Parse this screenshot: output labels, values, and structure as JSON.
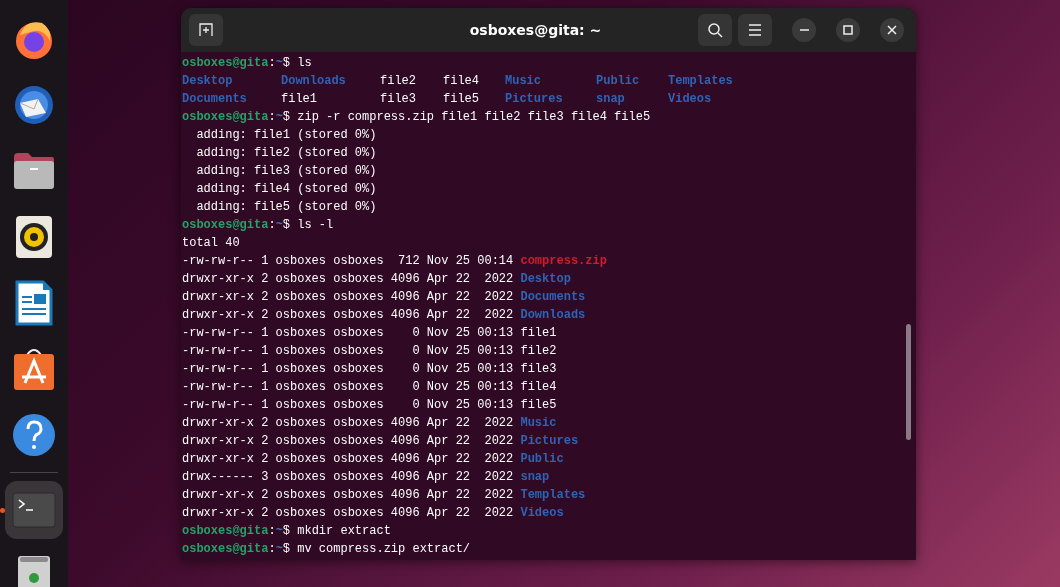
{
  "dock": {
    "items": [
      {
        "kind": "firefox",
        "running": false
      },
      {
        "kind": "mail",
        "running": false
      },
      {
        "kind": "files",
        "running": false
      },
      {
        "kind": "music",
        "running": false
      },
      {
        "kind": "writer",
        "running": false
      },
      {
        "kind": "store",
        "running": false
      },
      {
        "kind": "help",
        "running": false
      },
      {
        "kind": "terminal",
        "running": true
      },
      {
        "kind": "trash",
        "running": false
      }
    ]
  },
  "window": {
    "title": "osboxes@gita: ~"
  },
  "terminal": {
    "lines": [
      {
        "kind": "prompt",
        "user": "osboxes@gita",
        "separator": ":",
        "path": "~",
        "command": "$ ls"
      },
      {
        "kind": "columns",
        "cells": [
          {
            "text": "Desktop",
            "color": "#2f63b5"
          },
          {
            "text": "Downloads",
            "color": "#2f63b5"
          },
          {
            "text": "file2",
            "color": "#ffffff"
          },
          {
            "text": "file4",
            "color": "#ffffff"
          },
          {
            "text": "Music",
            "color": "#2f63b5"
          },
          {
            "text": "Public",
            "color": "#2f63b5"
          },
          {
            "text": "Templates",
            "color": "#2f63b5"
          }
        ]
      },
      {
        "kind": "columns",
        "cells": [
          {
            "text": "Documents",
            "color": "#2f63b5"
          },
          {
            "text": "file1",
            "color": "#ffffff"
          },
          {
            "text": "file3",
            "color": "#ffffff"
          },
          {
            "text": "file5",
            "color": "#ffffff"
          },
          {
            "text": "Pictures",
            "color": "#2f63b5"
          },
          {
            "text": "snap",
            "color": "#2f63b5"
          },
          {
            "text": "Videos",
            "color": "#2f63b5"
          }
        ]
      },
      {
        "kind": "prompt",
        "user": "osboxes@gita",
        "separator": ":",
        "path": "~",
        "command": "$ zip -r compress.zip file1 file2 file3 file4 file5"
      },
      {
        "kind": "text",
        "text": "  adding: file1 (stored 0%)"
      },
      {
        "kind": "text",
        "text": "  adding: file2 (stored 0%)"
      },
      {
        "kind": "text",
        "text": "  adding: file3 (stored 0%)"
      },
      {
        "kind": "text",
        "text": "  adding: file4 (stored 0%)"
      },
      {
        "kind": "text",
        "text": "  adding: file5 (stored 0%)"
      },
      {
        "kind": "prompt",
        "user": "osboxes@gita",
        "separator": ":",
        "path": "~",
        "command": "$ ls -l"
      },
      {
        "kind": "text",
        "text": "total 40"
      },
      {
        "kind": "listing",
        "meta": "-rw-rw-r-- 1 osboxes osboxes  712 Nov 25 00:14",
        "name": "compress.zip",
        "color": "#d01b2d"
      },
      {
        "kind": "listing",
        "meta": "drwxr-xr-x 2 osboxes osboxes 4096 Apr 22  2022",
        "name": "Desktop",
        "color": "#2f63b5"
      },
      {
        "kind": "listing",
        "meta": "drwxr-xr-x 2 osboxes osboxes 4096 Apr 22  2022",
        "name": "Documents",
        "color": "#2f63b5"
      },
      {
        "kind": "listing",
        "meta": "drwxr-xr-x 2 osboxes osboxes 4096 Apr 22  2022",
        "name": "Downloads",
        "color": "#2f63b5"
      },
      {
        "kind": "listing",
        "meta": "-rw-rw-r-- 1 osboxes osboxes    0 Nov 25 00:13",
        "name": "file1",
        "color": "#ffffff"
      },
      {
        "kind": "listing",
        "meta": "-rw-rw-r-- 1 osboxes osboxes    0 Nov 25 00:13",
        "name": "file2",
        "color": "#ffffff"
      },
      {
        "kind": "listing",
        "meta": "-rw-rw-r-- 1 osboxes osboxes    0 Nov 25 00:13",
        "name": "file3",
        "color": "#ffffff"
      },
      {
        "kind": "listing",
        "meta": "-rw-rw-r-- 1 osboxes osboxes    0 Nov 25 00:13",
        "name": "file4",
        "color": "#ffffff"
      },
      {
        "kind": "listing",
        "meta": "-rw-rw-r-- 1 osboxes osboxes    0 Nov 25 00:13",
        "name": "file5",
        "color": "#ffffff"
      },
      {
        "kind": "listing",
        "meta": "drwxr-xr-x 2 osboxes osboxes 4096 Apr 22  2022",
        "name": "Music",
        "color": "#2f63b5"
      },
      {
        "kind": "listing",
        "meta": "drwxr-xr-x 2 osboxes osboxes 4096 Apr 22  2022",
        "name": "Pictures",
        "color": "#2f63b5"
      },
      {
        "kind": "listing",
        "meta": "drwxr-xr-x 2 osboxes osboxes 4096 Apr 22  2022",
        "name": "Public",
        "color": "#2f63b5"
      },
      {
        "kind": "listing",
        "meta": "drwx------ 3 osboxes osboxes 4096 Apr 22  2022",
        "name": "snap",
        "color": "#2f63b5"
      },
      {
        "kind": "listing",
        "meta": "drwxr-xr-x 2 osboxes osboxes 4096 Apr 22  2022",
        "name": "Templates",
        "color": "#2f63b5"
      },
      {
        "kind": "listing",
        "meta": "drwxr-xr-x 2 osboxes osboxes 4096 Apr 22  2022",
        "name": "Videos",
        "color": "#2f63b5"
      },
      {
        "kind": "prompt",
        "user": "osboxes@gita",
        "separator": ":",
        "path": "~",
        "command": "$ mkdir extract"
      },
      {
        "kind": "prompt",
        "user": "osboxes@gita",
        "separator": ":",
        "path": "~",
        "command": "$ mv compress.zip extract/"
      }
    ]
  }
}
